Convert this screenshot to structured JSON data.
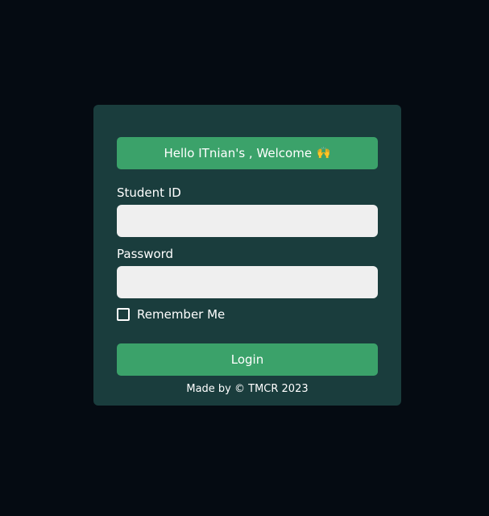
{
  "colors": {
    "background": "#050b12",
    "card": "#1a3d3d",
    "accent": "#3ba26a",
    "input_bg": "#efefef",
    "text": "#ffffff"
  },
  "login_card": {
    "welcome_text": "Hello ITnian's , Welcome",
    "welcome_emoji": "🙌",
    "student_id": {
      "label": "Student ID",
      "value": "",
      "placeholder": ""
    },
    "password": {
      "label": "Password",
      "value": "",
      "placeholder": ""
    },
    "remember_me": {
      "label": "Remember Me",
      "checked": false
    },
    "login_button": "Login",
    "footer": "Made by © TMCR 2023"
  }
}
